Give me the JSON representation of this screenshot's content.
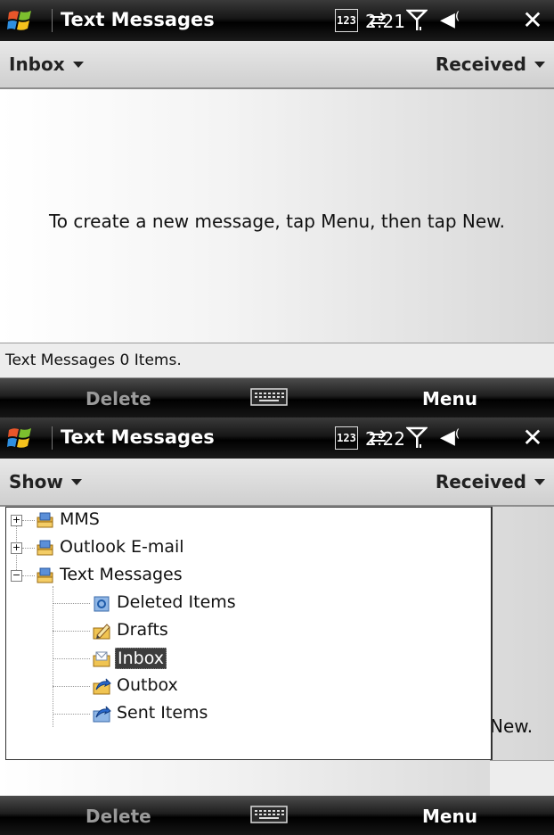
{
  "screen1": {
    "title": "Text Messages",
    "indicator_123": "123",
    "clock": "2:21",
    "close_label": "✕",
    "header": {
      "left": "Inbox",
      "right": "Received"
    },
    "empty_message": "To create a new message, tap Menu, then tap New.",
    "count_text": "Text Messages  0 Items.",
    "softkeys": {
      "left": "Delete",
      "right": "Menu"
    }
  },
  "screen2": {
    "title": "Text Messages",
    "indicator_123": "123",
    "clock": "2:22",
    "close_label": "✕",
    "header": {
      "left": "Show",
      "right": "Received"
    },
    "behind_text": "New.",
    "tree": {
      "items": [
        {
          "label": "MMS",
          "expander": "+",
          "icon": "mailbox-folder-icon"
        },
        {
          "label": "Outlook E-mail",
          "expander": "+",
          "icon": "mailbox-folder-icon"
        },
        {
          "label": "Text Messages",
          "expander": "−",
          "icon": "mailbox-folder-icon"
        },
        {
          "label": "Deleted Items",
          "icon": "deleted-items-icon"
        },
        {
          "label": "Drafts",
          "icon": "drafts-icon"
        },
        {
          "label": "Inbox",
          "icon": "inbox-icon",
          "selected": true
        },
        {
          "label": "Outbox",
          "icon": "outbox-icon"
        },
        {
          "label": "Sent Items",
          "icon": "sent-items-icon"
        }
      ]
    },
    "softkeys": {
      "left": "Delete",
      "right": "Menu"
    }
  },
  "colors": {
    "titlebar": "#000000",
    "headerbar": "#d6d6d6",
    "selection": "#3c3c3c"
  }
}
